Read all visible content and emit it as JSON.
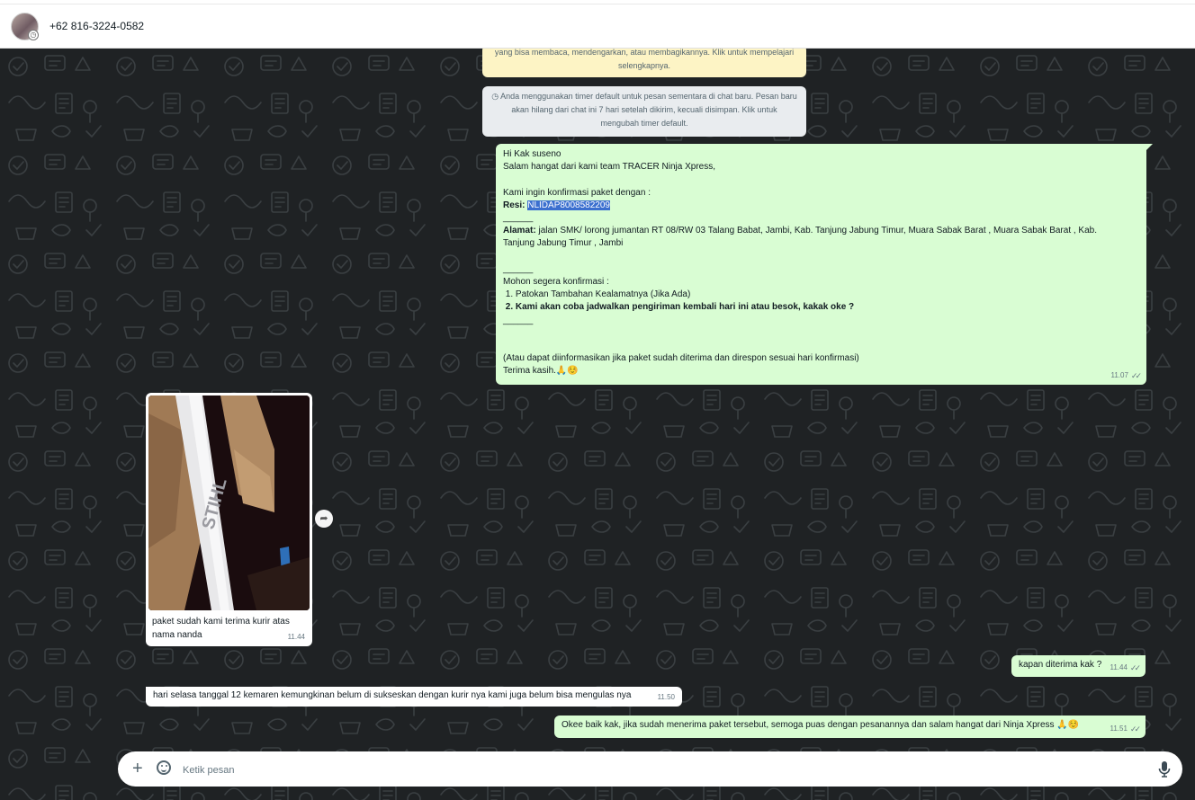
{
  "header": {
    "contact_name": "+62 816-3224-0582"
  },
  "system_messages": {
    "encryption": "yang bisa membaca, mendengarkan, atau membagikannya. Klik untuk mempelajari selengkapnya.",
    "timer": "Anda menggunakan timer default untuk pesan sementara di chat baru. Pesan baru akan hilang dari chat ini 7 hari setelah dikirim, kecuali disimpan. Klik untuk mengubah timer default."
  },
  "messages": {
    "confirm": {
      "greeting": "Hi Kak suseno",
      "intro": "Salam hangat dari kami team TRACER Ninja Xpress,",
      "confirm_line": "Kami ingin konfirmasi paket dengan :",
      "resi_label": "Resi:",
      "resi_value": "NLIDAP8008582209",
      "divider": "______",
      "alamat_label": "Alamat:",
      "alamat_value": " jalan SMK/ lorong jumantan RT 08/RW 03 Talang Babat, Jambi, Kab. Tanjung Jabung Timur, Muara Sabak Barat , Muara Sabak Barat , Kab.",
      "alamat_value2": "Tanjung Jabung Timur , Jambi",
      "divider2": "______",
      "request": "Mohon segera konfirmasi :",
      "item1": " 1. Patokan Tambahan Kealamatnya (Jika Ada)",
      "item2": " 2. Kami akan coba jadwalkan pengiriman kembali hari ini atau besok, kakak oke ?",
      "divider3": "______",
      "info": "(Atau dapat diinformasikan jika paket sudah diterima dan direspon sesuai hari konfirmasi)",
      "thanks": "Terima kasih.🙏☺️",
      "time": "11.07"
    },
    "photo": {
      "caption": "paket sudah kami terima kurir atas nama nanda",
      "time": "11.44",
      "brand_text": "STIHL"
    },
    "question": {
      "text": "kapan diterima kak ?",
      "time": "11.44"
    },
    "reply": {
      "text": "hari selasa tanggal 12 kemaren kemungkinan belum di sukseskan dengan kurir nya kami juga belum bisa mengulas nya",
      "time": "11.50"
    },
    "closing": {
      "text": "Okee baik kak, jika sudah menerima paket tersebut, semoga puas dengan pesanannya dan salam hangat dari Ninja Xpress 🙏☺️",
      "time": "11.51"
    }
  },
  "composer": {
    "placeholder": "Ketik pesan"
  },
  "colors": {
    "outgoing_bubble": "#d9fdd3",
    "incoming_bubble": "#ffffff",
    "chat_background": "#1f2224",
    "highlight": "#3b6fcf"
  }
}
